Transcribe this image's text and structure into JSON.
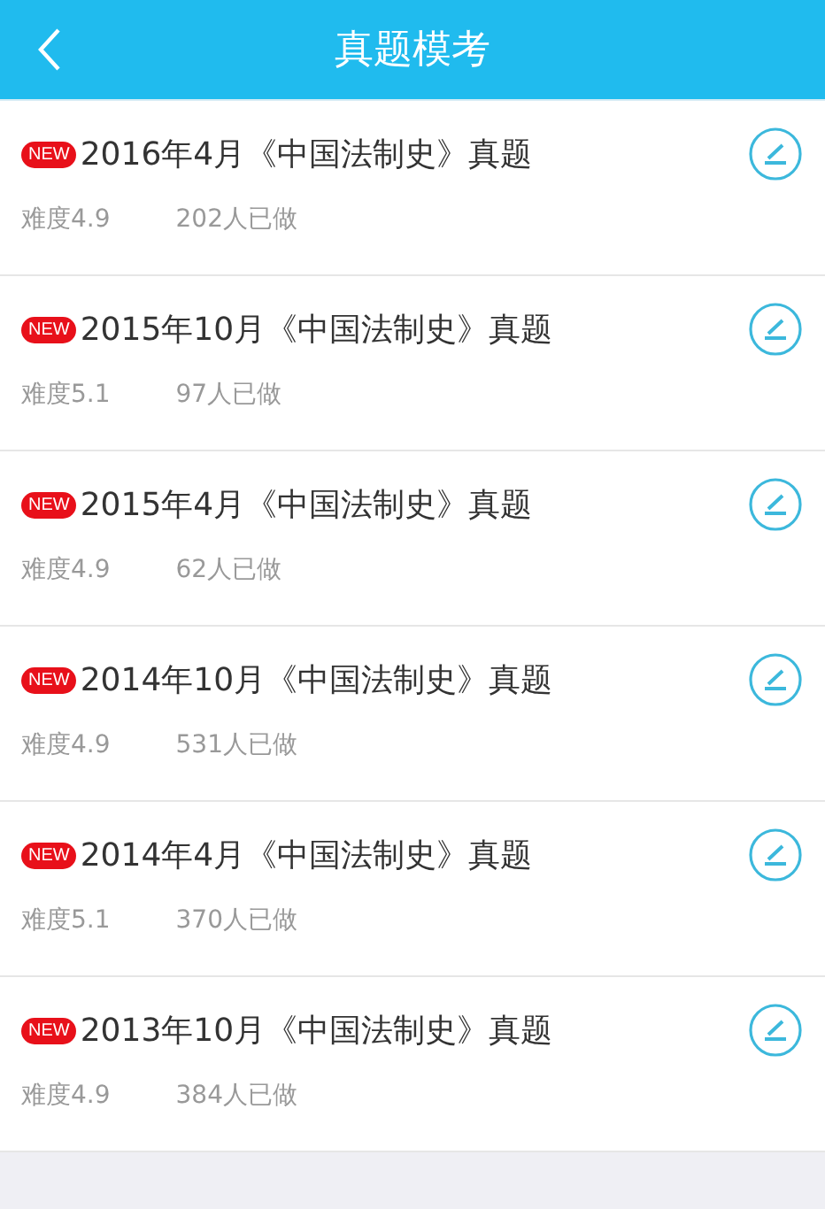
{
  "header": {
    "title": "真题模考"
  },
  "exams": [
    {
      "badge": "NEW",
      "title": "2016年4月《中国法制史》真题",
      "difficulty": "难度4.9",
      "count": "202人已做"
    },
    {
      "badge": "NEW",
      "title": "2015年10月《中国法制史》真题",
      "difficulty": "难度5.1",
      "count": "97人已做"
    },
    {
      "badge": "NEW",
      "title": "2015年4月《中国法制史》真题",
      "difficulty": "难度4.9",
      "count": "62人已做"
    },
    {
      "badge": "NEW",
      "title": "2014年10月《中国法制史》真题",
      "difficulty": "难度4.9",
      "count": "531人已做"
    },
    {
      "badge": "NEW",
      "title": "2014年4月《中国法制史》真题",
      "difficulty": "难度5.1",
      "count": "370人已做"
    },
    {
      "badge": "NEW",
      "title": "2013年10月《中国法制史》真题",
      "difficulty": "难度4.9",
      "count": "384人已做"
    }
  ]
}
